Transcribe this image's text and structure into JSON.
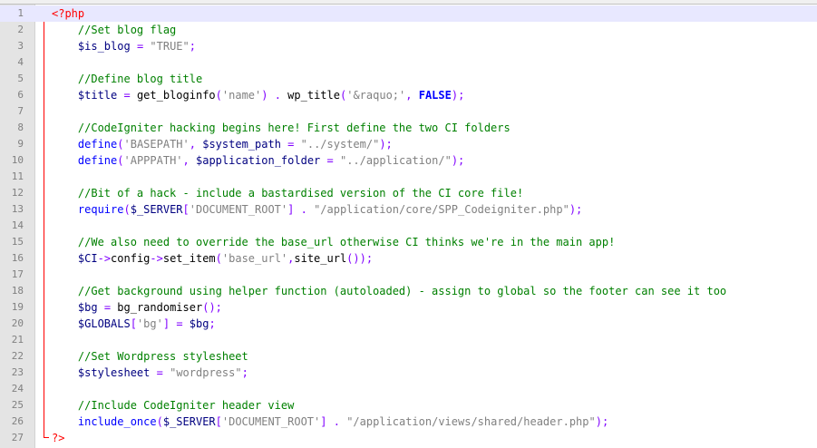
{
  "editor": {
    "current_line": 1,
    "lines": [
      {
        "n": "1",
        "tokens": [
          [
            "tag",
            "<?php"
          ]
        ]
      },
      {
        "n": "2",
        "tokens": [
          [
            "p",
            "    "
          ],
          [
            "cmt",
            "//Set blog flag"
          ]
        ]
      },
      {
        "n": "3",
        "tokens": [
          [
            "p",
            "    "
          ],
          [
            "var",
            "$is_blog"
          ],
          [
            "p",
            " "
          ],
          [
            "op",
            "="
          ],
          [
            "p",
            " "
          ],
          [
            "str",
            "\"TRUE\""
          ],
          [
            "op",
            ";"
          ]
        ]
      },
      {
        "n": "4",
        "tokens": []
      },
      {
        "n": "5",
        "tokens": [
          [
            "p",
            "    "
          ],
          [
            "cmt",
            "//Define blog title"
          ]
        ]
      },
      {
        "n": "6",
        "tokens": [
          [
            "p",
            "    "
          ],
          [
            "var",
            "$title"
          ],
          [
            "p",
            " "
          ],
          [
            "op",
            "="
          ],
          [
            "p",
            " get_bloginfo"
          ],
          [
            "op",
            "("
          ],
          [
            "str",
            "'name'"
          ],
          [
            "op",
            ")"
          ],
          [
            "p",
            " "
          ],
          [
            "op",
            "."
          ],
          [
            "p",
            " wp_title"
          ],
          [
            "op",
            "("
          ],
          [
            "str",
            "'&raquo;'"
          ],
          [
            "op",
            ","
          ],
          [
            "p",
            " "
          ],
          [
            "kw-b",
            "FALSE"
          ],
          [
            "op",
            ");"
          ]
        ]
      },
      {
        "n": "7",
        "tokens": []
      },
      {
        "n": "8",
        "tokens": [
          [
            "p",
            "    "
          ],
          [
            "cmt",
            "//CodeIgniter hacking begins here! First define the two CI folders"
          ]
        ]
      },
      {
        "n": "9",
        "tokens": [
          [
            "p",
            "    "
          ],
          [
            "kw",
            "define"
          ],
          [
            "op",
            "("
          ],
          [
            "str",
            "'BASEPATH'"
          ],
          [
            "op",
            ","
          ],
          [
            "p",
            " "
          ],
          [
            "var",
            "$system_path"
          ],
          [
            "p",
            " "
          ],
          [
            "op",
            "="
          ],
          [
            "p",
            " "
          ],
          [
            "str",
            "\"../system/\""
          ],
          [
            "op",
            ");"
          ]
        ]
      },
      {
        "n": "10",
        "tokens": [
          [
            "p",
            "    "
          ],
          [
            "kw",
            "define"
          ],
          [
            "op",
            "("
          ],
          [
            "str",
            "'APPPATH'"
          ],
          [
            "op",
            ","
          ],
          [
            "p",
            " "
          ],
          [
            "var",
            "$application_folder"
          ],
          [
            "p",
            " "
          ],
          [
            "op",
            "="
          ],
          [
            "p",
            " "
          ],
          [
            "str",
            "\"../application/\""
          ],
          [
            "op",
            ");"
          ]
        ]
      },
      {
        "n": "11",
        "tokens": []
      },
      {
        "n": "12",
        "tokens": [
          [
            "p",
            "    "
          ],
          [
            "cmt",
            "//Bit of a hack - include a bastardised version of the CI core file!"
          ]
        ]
      },
      {
        "n": "13",
        "tokens": [
          [
            "p",
            "    "
          ],
          [
            "kw",
            "require"
          ],
          [
            "op",
            "("
          ],
          [
            "var",
            "$_SERVER"
          ],
          [
            "op",
            "["
          ],
          [
            "str",
            "'DOCUMENT_ROOT'"
          ],
          [
            "op",
            "]"
          ],
          [
            "p",
            " "
          ],
          [
            "op",
            "."
          ],
          [
            "p",
            " "
          ],
          [
            "str",
            "\"/application/core/SPP_Codeigniter.php\""
          ],
          [
            "op",
            ");"
          ]
        ]
      },
      {
        "n": "14",
        "tokens": []
      },
      {
        "n": "15",
        "tokens": [
          [
            "p",
            "    "
          ],
          [
            "cmt",
            "//We also need to override the base_url otherwise CI thinks we're in the main app!"
          ]
        ]
      },
      {
        "n": "16",
        "tokens": [
          [
            "p",
            "    "
          ],
          [
            "var",
            "$CI"
          ],
          [
            "op",
            "->"
          ],
          [
            "p",
            "config"
          ],
          [
            "op",
            "->"
          ],
          [
            "p",
            "set_item"
          ],
          [
            "op",
            "("
          ],
          [
            "str",
            "'base_url'"
          ],
          [
            "op",
            ","
          ],
          [
            "p",
            "site_url"
          ],
          [
            "op",
            "());"
          ]
        ]
      },
      {
        "n": "17",
        "tokens": []
      },
      {
        "n": "18",
        "tokens": [
          [
            "p",
            "    "
          ],
          [
            "cmt",
            "//Get background using helper function (autoloaded) - assign to global so the footer can see it too"
          ]
        ]
      },
      {
        "n": "19",
        "tokens": [
          [
            "p",
            "    "
          ],
          [
            "var",
            "$bg"
          ],
          [
            "p",
            " "
          ],
          [
            "op",
            "="
          ],
          [
            "p",
            " bg_randomiser"
          ],
          [
            "op",
            "();"
          ]
        ]
      },
      {
        "n": "20",
        "tokens": [
          [
            "p",
            "    "
          ],
          [
            "var",
            "$GLOBALS"
          ],
          [
            "op",
            "["
          ],
          [
            "str",
            "'bg'"
          ],
          [
            "op",
            "]"
          ],
          [
            "p",
            " "
          ],
          [
            "op",
            "="
          ],
          [
            "p",
            " "
          ],
          [
            "var",
            "$bg"
          ],
          [
            "op",
            ";"
          ]
        ]
      },
      {
        "n": "21",
        "tokens": []
      },
      {
        "n": "22",
        "tokens": [
          [
            "p",
            "    "
          ],
          [
            "cmt",
            "//Set Wordpress stylesheet"
          ]
        ]
      },
      {
        "n": "23",
        "tokens": [
          [
            "p",
            "    "
          ],
          [
            "var",
            "$stylesheet"
          ],
          [
            "p",
            " "
          ],
          [
            "op",
            "="
          ],
          [
            "p",
            " "
          ],
          [
            "str",
            "\"wordpress\""
          ],
          [
            "op",
            ";"
          ]
        ]
      },
      {
        "n": "24",
        "tokens": []
      },
      {
        "n": "25",
        "tokens": [
          [
            "p",
            "    "
          ],
          [
            "cmt",
            "//Include CodeIgniter header view"
          ]
        ]
      },
      {
        "n": "26",
        "tokens": [
          [
            "p",
            "    "
          ],
          [
            "kw",
            "include_once"
          ],
          [
            "op",
            "("
          ],
          [
            "var",
            "$_SERVER"
          ],
          [
            "op",
            "["
          ],
          [
            "str",
            "'DOCUMENT_ROOT'"
          ],
          [
            "op",
            "]"
          ],
          [
            "p",
            " "
          ],
          [
            "op",
            "."
          ],
          [
            "p",
            " "
          ],
          [
            "str",
            "\"/application/views/shared/header.php\""
          ],
          [
            "op",
            ");"
          ]
        ]
      },
      {
        "n": "27",
        "tokens": [
          [
            "tag",
            "?>"
          ]
        ]
      }
    ]
  },
  "colors": {
    "comment": "#008000",
    "variable": "#000080",
    "string": "#808080",
    "operator": "#8000ff",
    "keyword": "#0000ff",
    "php_tag": "#ff0000",
    "current_line_bg": "#e8e8ff",
    "gutter_bg": "#e4e4e4"
  },
  "icons": {
    "fold_open": "minus-box-icon"
  }
}
